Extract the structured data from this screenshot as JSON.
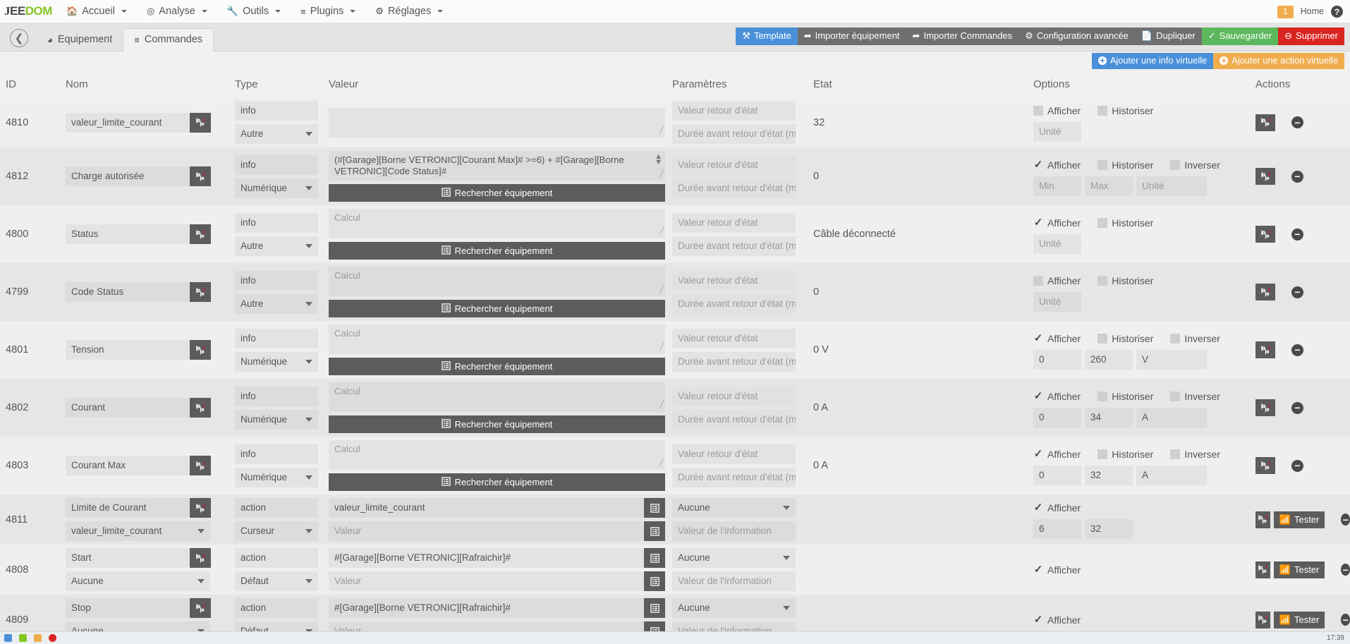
{
  "navbar": {
    "brand": "EEDOM",
    "brand_prefix": "J",
    "items": [
      {
        "label": "Accueil",
        "icon": "home-icon"
      },
      {
        "label": "Analyse",
        "icon": "stethoscope-icon"
      },
      {
        "label": "Outils",
        "icon": "wrench-icon"
      },
      {
        "label": "Plugins",
        "icon": "list-icon"
      },
      {
        "label": "Réglages",
        "icon": "gear-icon"
      }
    ],
    "badge_count": "1",
    "user_name": "Home",
    "help_label": "?"
  },
  "tabbar": {
    "back_label": "",
    "tabs": [
      {
        "label": "Equipement",
        "icon": "dashboard-icon",
        "active": false
      },
      {
        "label": "Commandes",
        "icon": "list-icon",
        "active": true
      }
    ],
    "actions": [
      {
        "label": "Template",
        "icon": "brush-icon",
        "color": "blue"
      },
      {
        "label": "Importer équipement",
        "icon": "share-icon",
        "color": "gray"
      },
      {
        "label": "Importer Commandes",
        "icon": "share-icon",
        "color": "gray"
      },
      {
        "label": "Configuration avancée",
        "icon": "cogs-icon",
        "color": "gray"
      },
      {
        "label": "Dupliquer",
        "icon": "copy-icon",
        "color": "gray"
      },
      {
        "label": "Sauvegarder",
        "icon": "check-circle-icon",
        "color": "green"
      },
      {
        "label": "Supprimer",
        "icon": "minus-circle-icon",
        "color": "red"
      }
    ]
  },
  "virtual_buttons": [
    {
      "label": "Ajouter une info virtuelle",
      "color": "blue",
      "icon": "plus-circle-icon"
    },
    {
      "label": "Ajouter une action virtuelle",
      "color": "orange",
      "icon": "plus-circle-icon"
    }
  ],
  "table": {
    "headers": [
      "ID",
      "Nom",
      "Type",
      "Valeur",
      "Paramètres",
      "Etat",
      "Options",
      "Actions"
    ],
    "placeholders": {
      "retour_etat": "Valeur retour d'état",
      "duree_retour": "Durée avant retour d'état (min)",
      "calcul": "Calcul",
      "unite": "Unité",
      "min": "Min",
      "max": "Max",
      "valeur": "Valeur",
      "valeur_info": "Valeur de l'information"
    },
    "labels": {
      "afficher": "Afficher",
      "historiser": "Historiser",
      "inverser": "Inverser",
      "rechercher": "Rechercher équipement",
      "tester": "Tester"
    },
    "rows": [
      {
        "id": "4810",
        "nom": "valeur_limite_courant",
        "kind": "info",
        "type_label": "info",
        "subtype": "Autre",
        "value": "",
        "value_is_placeholder": false,
        "has_search_button": false,
        "etat": "32",
        "afficher": false,
        "historiser": false,
        "has_inverser": false,
        "inverser": false,
        "min": "",
        "max": "",
        "unite": "",
        "show_minmax": false,
        "has_test": false
      },
      {
        "id": "4812",
        "nom": "Charge autorisée",
        "kind": "info",
        "type_label": "info",
        "subtype": "Numérique",
        "value": "(#[Garage][Borne VETRONIC][Courant Max]# >=6) + #[Garage][Borne VETRONIC][Code Status]#",
        "value_is_placeholder": false,
        "has_search_button": true,
        "etat": "0",
        "afficher": true,
        "historiser": false,
        "has_inverser": true,
        "inverser": false,
        "min": "",
        "max": "",
        "unite": "",
        "show_minmax": true,
        "has_test": false
      },
      {
        "id": "4800",
        "nom": "Status",
        "kind": "info",
        "type_label": "info",
        "subtype": "Autre",
        "value": "Calcul",
        "value_is_placeholder": true,
        "has_search_button": true,
        "etat": "Câble déconnecté",
        "afficher": true,
        "historiser": false,
        "has_inverser": false,
        "inverser": false,
        "min": "",
        "max": "",
        "unite": "",
        "show_minmax": false,
        "has_test": false
      },
      {
        "id": "4799",
        "nom": "Code Status",
        "kind": "info",
        "type_label": "info",
        "subtype": "Autre",
        "value": "Calcul",
        "value_is_placeholder": true,
        "has_search_button": true,
        "etat": "0",
        "afficher": false,
        "historiser": false,
        "has_inverser": false,
        "inverser": false,
        "min": "",
        "max": "",
        "unite": "",
        "show_minmax": false,
        "has_test": false
      },
      {
        "id": "4801",
        "nom": "Tension",
        "kind": "info",
        "type_label": "info",
        "subtype": "Numérique",
        "value": "Calcul",
        "value_is_placeholder": true,
        "has_search_button": true,
        "etat": "0 V",
        "afficher": true,
        "historiser": false,
        "has_inverser": true,
        "inverser": false,
        "min": "0",
        "max": "260",
        "unite": "V",
        "show_minmax": true,
        "has_test": false
      },
      {
        "id": "4802",
        "nom": "Courant",
        "kind": "info",
        "type_label": "info",
        "subtype": "Numérique",
        "value": "Calcul",
        "value_is_placeholder": true,
        "has_search_button": true,
        "etat": "0 A",
        "afficher": true,
        "historiser": false,
        "has_inverser": true,
        "inverser": false,
        "min": "0",
        "max": "34",
        "unite": "A",
        "show_minmax": true,
        "has_test": false
      },
      {
        "id": "4803",
        "nom": "Courant Max",
        "kind": "info",
        "type_label": "info",
        "subtype": "Numérique",
        "value": "Calcul",
        "value_is_placeholder": true,
        "has_search_button": true,
        "etat": "0 A",
        "afficher": true,
        "historiser": false,
        "has_inverser": true,
        "inverser": false,
        "min": "0",
        "max": "32",
        "unite": "A",
        "show_minmax": true,
        "has_test": false
      },
      {
        "id": "4811",
        "nom": "Limite de Courant",
        "kind": "action",
        "type_label": "action",
        "subtype": "Curseur",
        "info_select": "valeur_limite_courant",
        "value": "valeur_limite_courant",
        "value2_placeholder": "Valeur",
        "param_select": "Aucune",
        "param2_placeholder": "Valeur de l'information",
        "etat": "",
        "afficher": true,
        "min": "6",
        "max": "32",
        "show_minmax": true,
        "has_test": true
      },
      {
        "id": "4808",
        "nom": "Start",
        "kind": "action",
        "type_label": "action",
        "subtype": "Défaut",
        "info_select": "Aucune",
        "value": "#[Garage][Borne VETRONIC][Rafraichir]#",
        "value2_placeholder": "Valeur",
        "param_select": "Aucune",
        "param2_placeholder": "Valeur de l'information",
        "etat": "",
        "afficher": true,
        "min": "",
        "max": "",
        "show_minmax": false,
        "has_test": true
      },
      {
        "id": "4809",
        "nom": "Stop",
        "kind": "action",
        "type_label": "action",
        "subtype": "Défaut",
        "info_select": "Aucune",
        "value": "#[Garage][Borne VETRONIC][Rafraichir]#",
        "value2_placeholder": "Valeur",
        "param_select": "Aucune",
        "param2_placeholder": "Valeur de l'information",
        "etat": "",
        "afficher": true,
        "min": "",
        "max": "",
        "show_minmax": false,
        "has_test": true
      }
    ]
  },
  "taskbar": {
    "clock": "17:39"
  },
  "colors": {
    "accent_blue": "#4a90d9",
    "green": "#5cb85c",
    "red": "#d9241f",
    "orange": "#f0ad4e",
    "dark": "#5c5c5c"
  }
}
